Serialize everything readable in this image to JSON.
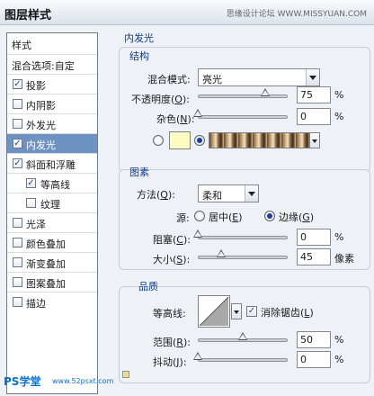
{
  "window": {
    "title": "图层样式",
    "watermark": "思缘设计论坛 WWW.MISSYUAN.COM"
  },
  "sidebar": {
    "header": "样式",
    "items": [
      {
        "label": "混合选项:自定",
        "checkbox": false,
        "checked": false,
        "selected": false
      },
      {
        "label": "投影",
        "checkbox": true,
        "checked": true,
        "selected": false
      },
      {
        "label": "内阴影",
        "checkbox": true,
        "checked": false,
        "selected": false
      },
      {
        "label": "外发光",
        "checkbox": true,
        "checked": false,
        "selected": false
      },
      {
        "label": "内发光",
        "checkbox": true,
        "checked": true,
        "selected": true
      },
      {
        "label": "斜面和浮雕",
        "checkbox": true,
        "checked": true,
        "selected": false
      },
      {
        "label": "等高线",
        "checkbox": true,
        "checked": true,
        "selected": false,
        "indent": true
      },
      {
        "label": "纹理",
        "checkbox": true,
        "checked": false,
        "selected": false,
        "indent": true
      },
      {
        "label": "光泽",
        "checkbox": true,
        "checked": false,
        "selected": false
      },
      {
        "label": "颜色叠加",
        "checkbox": true,
        "checked": false,
        "selected": false
      },
      {
        "label": "渐变叠加",
        "checkbox": true,
        "checked": false,
        "selected": false
      },
      {
        "label": "图案叠加",
        "checkbox": true,
        "checked": false,
        "selected": false
      },
      {
        "label": "描边",
        "checkbox": true,
        "checked": false,
        "selected": false
      }
    ]
  },
  "panel": {
    "title": "内发光",
    "structure": {
      "title": "结构",
      "blend_mode_label": "混合模式:",
      "blend_mode_value": "亮光",
      "opacity_label": "不透明度(",
      "opacity_key": "O",
      "opacity_label_end": "):",
      "opacity_value": "75",
      "opacity_level": 0.75,
      "noise_label": "杂色(",
      "noise_key": "N",
      "noise_label_end": "):",
      "noise_value": "0",
      "noise_level": 0,
      "percent": "%",
      "color_swatch": "#fdfbc0",
      "gradient_selected": true
    },
    "elements": {
      "title": "图素",
      "method_label": "方法(",
      "method_key": "Q",
      "method_label_end": "):",
      "method_value": "柔和",
      "source_label": "源:",
      "source_center": "居中(",
      "source_center_key": "E",
      "source_center_end": ")",
      "source_edge": "边缘(",
      "source_edge_key": "G",
      "source_edge_end": ")",
      "source_selected": "edge",
      "choke_label": "阻塞(",
      "choke_key": "C",
      "choke_label_end": "):",
      "choke_value": "0",
      "choke_level": 0,
      "size_label": "大小(",
      "size_key": "S",
      "size_label_end": "):",
      "size_value": "45",
      "size_unit": "像素",
      "percent": "%"
    },
    "quality": {
      "title": "品质",
      "contour_label": "等高线:",
      "antialias_label": "消除锯齿(",
      "antialias_key": "L",
      "antialias_end": ")",
      "antialias_checked": true,
      "range_label": "范围(",
      "range_key": "R",
      "range_label_end": "):",
      "range_value": "50",
      "range_level": 0.5,
      "jitter_label": "抖动(",
      "jitter_key": "J",
      "jitter_label_end": "):",
      "jitter_value": "0",
      "jitter_level": 0,
      "percent": "%"
    }
  },
  "logo": {
    "text": "PS学堂",
    "url": "www.52psxt.com"
  }
}
